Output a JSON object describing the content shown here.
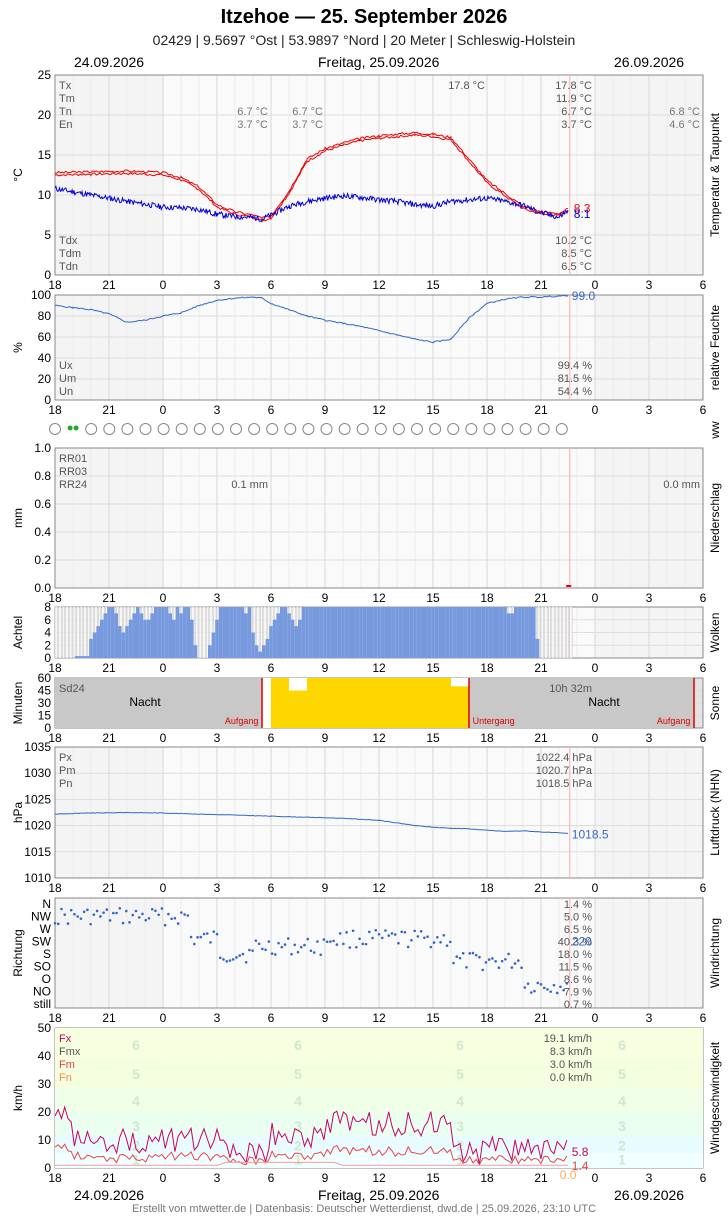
{
  "header": {
    "title": "Itzehoe  —  25. September 2026",
    "subtitle": "02429  |  9.5697 °Ost  |  53.9897 °Nord  |  20 Meter  |  Schleswig-Holstein",
    "date_left": "24.09.2026",
    "date_center": "Freitag, 25.09.2026",
    "date_right": "26.09.2026"
  },
  "footer": "Erstellt von mtwetter.de | Datenbasis: Deutscher Wetterdienst, dwd.de | 25.09.2026, 23:10 UTC",
  "colors": {
    "temp": "#ee0000",
    "dew": "#0000dd",
    "humidity": "#3366cc",
    "clouds": "#7799dd",
    "sun": "#ffd700",
    "gust": "#cc0066",
    "mean_wind": "#ee4444"
  },
  "chart_data": [
    {
      "id": "temperature",
      "type": "line",
      "ylabel": "°C",
      "side_label": "Temperatur & Taupunkt",
      "ylim": [
        0,
        25
      ],
      "yticks": [
        "0",
        "5",
        "10",
        "15",
        "20",
        "25"
      ],
      "xticks": [
        "18",
        "21",
        "0",
        "3",
        "6",
        "9",
        "12",
        "15",
        "18",
        "21",
        "0",
        "3",
        "6"
      ],
      "series": [
        {
          "name": "Temperatur",
          "color": "#ee0000",
          "x": [
            -6,
            -4,
            -2,
            0,
            1,
            2,
            3,
            4,
            5,
            5.5,
            6,
            7,
            8,
            9,
            10,
            11,
            12,
            13,
            14,
            15,
            16,
            17,
            18,
            19,
            20,
            21,
            22,
            22.5
          ],
          "values": [
            12.8,
            12.9,
            13.0,
            12.8,
            12.2,
            11.0,
            8.8,
            7.9,
            7.5,
            7.1,
            7.4,
            10.5,
            14.5,
            15.8,
            16.5,
            17.1,
            17.4,
            17.6,
            17.8,
            17.6,
            17.2,
            14.5,
            11.8,
            10.2,
            8.6,
            7.9,
            7.7,
            8.3
          ]
        },
        {
          "name": "Taupunkt",
          "color": "#0000dd",
          "x": [
            -6,
            -4,
            -2,
            0,
            1,
            2,
            3,
            4,
            5,
            5.5,
            6,
            7,
            8,
            9,
            10,
            11,
            12,
            13,
            14,
            15,
            16,
            17,
            18,
            19,
            20,
            21,
            22,
            22.5
          ],
          "values": [
            10.8,
            10.0,
            9.2,
            8.5,
            8.4,
            8.2,
            7.6,
            7.3,
            7.2,
            7.0,
            7.5,
            8.6,
            9.2,
            9.6,
            9.9,
            9.7,
            9.4,
            9.2,
            8.8,
            8.6,
            9.2,
            9.4,
            9.6,
            9.2,
            8.7,
            7.8,
            7.2,
            8.1
          ]
        }
      ],
      "end_labels": [
        "8.3",
        "8.1"
      ],
      "stats_top": [
        [
          "Tx",
          "17.8 °C"
        ],
        [
          "Tm",
          "11.9 °C"
        ],
        [
          "Tn",
          "6.7 °C"
        ],
        [
          "En",
          "3.7 °C"
        ]
      ],
      "stats_prev_night": [
        [
          "Tn",
          "6.7 °C"
        ],
        [
          "En",
          "3.7 °C"
        ]
      ],
      "stats_night2": [
        [
          "Tn",
          "6.7 °C"
        ],
        [
          "En",
          "3.7 °C"
        ]
      ],
      "stats_next": [
        [
          "Tn",
          "6.8 °C"
        ],
        [
          "En",
          "4.6 °C"
        ]
      ],
      "tx_marker": "17.8 °C",
      "stats_bottom": [
        [
          "Tdx",
          "10.2 °C"
        ],
        [
          "Tdm",
          "8.5 °C"
        ],
        [
          "Tdn",
          "6.5 °C"
        ]
      ]
    },
    {
      "id": "humidity",
      "type": "line",
      "ylabel": "%",
      "side_label": "relative Feuchte",
      "ylim": [
        0,
        100
      ],
      "yticks": [
        "0",
        "20",
        "40",
        "60",
        "80",
        "100"
      ],
      "series": [
        {
          "name": "Feuchte",
          "color": "#3366cc",
          "x": [
            -6,
            -5,
            -4,
            -3,
            -2,
            -1,
            0,
            1,
            2,
            3,
            4,
            5,
            5.5,
            6,
            7,
            8,
            9,
            10,
            11,
            12,
            13,
            14,
            15,
            16,
            17,
            18,
            19,
            20,
            21,
            22,
            22.5
          ],
          "values": [
            90,
            88,
            86,
            82,
            74,
            76,
            80,
            83,
            90,
            95,
            97,
            98,
            97,
            92,
            86,
            80,
            76,
            73,
            70,
            66,
            62,
            58,
            55,
            58,
            78,
            92,
            96,
            98,
            98,
            99,
            99
          ]
        }
      ],
      "end_labels": [
        "99.0"
      ],
      "stats": [
        [
          "Ux",
          "99.4 %"
        ],
        [
          "Um",
          "81.5 %"
        ],
        [
          "Un",
          "54.4 %"
        ]
      ]
    },
    {
      "id": "ww",
      "type": "table",
      "side_label": "ww",
      "symbols": [
        "circle",
        "drizzle",
        "circle",
        "circle",
        "circle",
        "circle",
        "circle",
        "circle",
        "circle",
        "circle",
        "circle",
        "circle",
        "circle",
        "circle",
        "circle",
        "circle",
        "circle",
        "circle",
        "circle",
        "circle",
        "circle",
        "circle",
        "circle",
        "circle",
        "circle",
        "circle",
        "circle",
        "circle",
        "circle"
      ]
    },
    {
      "id": "precipitation",
      "type": "bar",
      "ylabel": "mm",
      "side_label": "Niederschlag",
      "ylim": [
        0,
        1.0
      ],
      "yticks": [
        "0.0",
        "0.2",
        "0.4",
        "0.6",
        "0.8",
        "1.0"
      ],
      "labels": [
        "RR01",
        "RR03",
        "RR24"
      ],
      "rr24_prev": "0.1 mm",
      "rr24_next": "0.0 mm",
      "values": []
    },
    {
      "id": "clouds",
      "type": "bar",
      "ylabel": "Achtel",
      "side_label": "Wolken",
      "ylim": [
        0,
        8
      ],
      "yticks": [
        "0",
        "2",
        "4",
        "6",
        "8"
      ],
      "x_start": -6,
      "x_step": 0.2,
      "values": [
        8,
        8,
        7,
        8,
        7,
        8,
        7,
        8,
        8,
        8,
        8,
        8,
        8,
        8,
        8,
        8,
        8,
        8,
        8,
        8,
        8,
        8,
        8,
        8,
        8,
        8,
        8,
        8,
        8,
        8,
        8,
        8,
        8,
        8,
        8,
        8,
        8,
        8,
        8,
        8,
        8,
        8,
        8,
        8,
        8,
        8,
        8,
        8,
        8,
        8,
        8,
        8,
        8,
        8,
        8,
        8,
        8,
        8,
        8,
        8,
        8,
        8,
        8,
        8,
        8,
        8,
        8,
        8,
        8,
        8,
        8,
        8,
        8,
        8,
        8,
        8,
        8,
        8,
        8,
        8,
        8,
        8,
        8,
        8,
        8,
        8,
        8,
        8,
        8,
        8,
        8,
        8,
        8,
        8,
        8,
        8,
        8,
        8,
        8,
        8,
        8,
        8,
        8,
        8,
        8,
        8,
        8,
        8,
        8,
        8,
        8,
        8,
        8,
        8,
        8,
        8,
        8,
        8,
        8,
        8,
        8,
        8,
        8,
        8,
        8,
        8,
        8,
        8,
        8,
        8,
        8,
        8,
        8,
        8,
        8,
        8,
        8,
        8,
        8,
        8,
        8,
        8,
        8,
        8,
        8,
        8,
        8,
        8,
        8,
        8,
        8,
        8,
        8,
        8,
        8,
        8,
        8,
        8,
        8,
        8,
        8,
        8,
        8,
        8,
        8
      ],
      "blue_from": [
        -0.8,
        22.4
      ],
      "blue_values": [
        0.3,
        0.3,
        0.3,
        0.3,
        3,
        4,
        5,
        6,
        7,
        8,
        8,
        7,
        5,
        4,
        5,
        6,
        7,
        8,
        7,
        6,
        6,
        7,
        8,
        8,
        8,
        8,
        7,
        6,
        8,
        7,
        8,
        8,
        6,
        2,
        0,
        0,
        0,
        2,
        4,
        6,
        8,
        8,
        8,
        8,
        8,
        8,
        8,
        7,
        8,
        4,
        2,
        1,
        2,
        3,
        5,
        6,
        7,
        8,
        8,
        7,
        6,
        5,
        6,
        8,
        8,
        8,
        8,
        8,
        8,
        8,
        8,
        8,
        8,
        8,
        8,
        8,
        8,
        8,
        8,
        8,
        8,
        8,
        8,
        8,
        8,
        8,
        8,
        8,
        8,
        8,
        8,
        8,
        8,
        8,
        8,
        8,
        8,
        8,
        8,
        8,
        8,
        8,
        8,
        8,
        8,
        8,
        8,
        8,
        8,
        8,
        8,
        8,
        8,
        8,
        8,
        8,
        8,
        8,
        8,
        8,
        7,
        7,
        8,
        8,
        8,
        8,
        8,
        8,
        3
      ]
    },
    {
      "id": "sunshine",
      "type": "bar",
      "ylabel": "Minuten",
      "side_label": "Sonne",
      "ylim": [
        0,
        60
      ],
      "yticks": [
        "0",
        "15",
        "30",
        "45",
        "60"
      ],
      "x": [
        5.5,
        6,
        7,
        8,
        9,
        10,
        11,
        12,
        13,
        14,
        15,
        16,
        16.5
      ],
      "values": [
        0,
        60,
        45,
        60,
        60,
        60,
        60,
        60,
        60,
        60,
        60,
        50,
        0
      ],
      "sd24_label": "Sd24",
      "sd24_value": "10h 32m",
      "night_label": "Nacht",
      "sunrise_label": "Aufgang",
      "sunset_label": "Untergang"
    },
    {
      "id": "pressure",
      "type": "line",
      "ylabel": "hPa",
      "side_label": "Luftdruck (NHN)",
      "ylim": [
        1010,
        1035
      ],
      "yticks": [
        "1010",
        "1015",
        "1020",
        "1025",
        "1030",
        "1035"
      ],
      "series": [
        {
          "name": "Luftdruck",
          "color": "#3366cc",
          "x": [
            -6,
            -4,
            -2,
            0,
            2,
            4,
            6,
            8,
            10,
            12,
            13,
            14,
            15,
            16,
            17,
            18,
            19,
            20,
            21,
            22,
            22.5
          ],
          "values": [
            1022.2,
            1022.4,
            1022.5,
            1022.4,
            1022.2,
            1022.0,
            1021.8,
            1021.6,
            1021.4,
            1021.0,
            1020.5,
            1020.0,
            1019.7,
            1019.5,
            1019.4,
            1019.1,
            1018.9,
            1019.0,
            1018.8,
            1018.6,
            1018.5
          ]
        }
      ],
      "end_labels": [
        "1018.5"
      ],
      "stats": [
        [
          "Px",
          "1022.4 hPa"
        ],
        [
          "Pm",
          "1020.7 hPa"
        ],
        [
          "Pn",
          "1018.5 hPa"
        ]
      ]
    },
    {
      "id": "wind_direction",
      "type": "scatter",
      "ylabel": "Richtung",
      "side_label": "Windrichtung",
      "categories": [
        "N",
        "NW",
        "W",
        "SW",
        "S",
        "SO",
        "O",
        "NO",
        "still"
      ],
      "end_labels": [
        "220"
      ],
      "stats": [
        "1.4 %",
        "5.0 %",
        "6.5 %",
        "40.3 %",
        "18.0 %",
        "11.5 %",
        "8.6 %",
        "7.9 %",
        "0.7 %"
      ]
    },
    {
      "id": "wind_speed",
      "type": "line",
      "ylabel": "km/h",
      "side_label": "Windgeschwindigkeit",
      "ylim": [
        0,
        50
      ],
      "yticks": [
        "0",
        "10",
        "20",
        "30",
        "40",
        "50"
      ],
      "beaufort": [
        "1",
        "2",
        "3",
        "4",
        "5",
        "6"
      ],
      "series": [
        {
          "name": "Fx",
          "color": "#cc0066"
        },
        {
          "name": "Fm",
          "color": "#ee4444"
        }
      ],
      "end_labels": [
        "5.8",
        "1.4",
        "0.0"
      ],
      "stats": [
        [
          "Fx",
          "19.1 km/h"
        ],
        [
          "Fmx",
          "8.3 km/h"
        ],
        [
          "Fm",
          "3.0 km/h"
        ],
        [
          "Fn",
          "0.0 km/h"
        ]
      ]
    }
  ]
}
